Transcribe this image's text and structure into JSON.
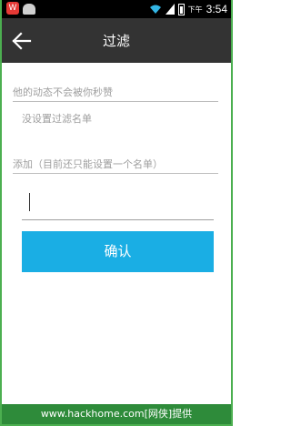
{
  "status_bar": {
    "app_icon_letter": "W",
    "ampm": "下午",
    "time": "3:54"
  },
  "header": {
    "title": "过滤"
  },
  "section_hidden": {
    "label": "他的动态不会被你秒赞",
    "empty_note": "没设置过滤名单"
  },
  "section_add": {
    "label": "添加（目前还只能设置一个名单）",
    "input_value": "",
    "input_placeholder": ""
  },
  "confirm_button": {
    "label": "确认"
  },
  "watermark": {
    "text": "www.hackhome.com[网侠]提供"
  },
  "colors": {
    "title_bar": "#333333",
    "accent": "#1aaee4",
    "watermark": "#2e8b3a"
  }
}
